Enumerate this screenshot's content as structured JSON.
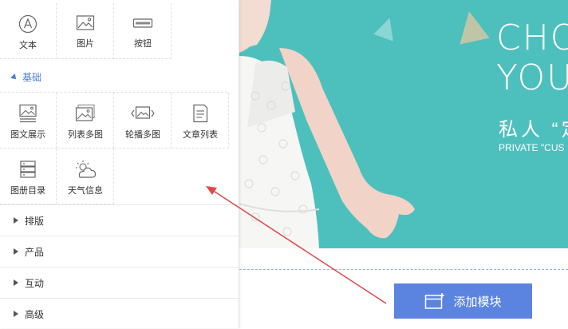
{
  "panel": {
    "top_items": [
      {
        "label": "文本",
        "icon": "text-icon"
      },
      {
        "label": "图片",
        "icon": "image-icon"
      },
      {
        "label": "按钮",
        "icon": "button-icon"
      }
    ],
    "basic_section": {
      "label": "基础",
      "items": [
        {
          "label": "图文展示",
          "icon": "image-text-icon"
        },
        {
          "label": "列表多图",
          "icon": "list-images-icon"
        },
        {
          "label": "轮播多图",
          "icon": "carousel-icon"
        },
        {
          "label": "文章列表",
          "icon": "article-list-icon"
        },
        {
          "label": "图册目录",
          "icon": "album-catalog-icon"
        },
        {
          "label": "天气信息",
          "icon": "weather-icon"
        }
      ]
    },
    "categories": [
      {
        "label": "排版"
      },
      {
        "label": "产品"
      },
      {
        "label": "互动"
      },
      {
        "label": "高级"
      }
    ]
  },
  "banner": {
    "line1": "CHO",
    "line2": "YOU",
    "cn": "私人 “定",
    "en": "PRIVATE \"CUS"
  },
  "add_module": {
    "label": "添加模块"
  },
  "colors": {
    "accent": "#5b84e0",
    "banner_bg": "#4dc0bd",
    "section_blue": "#4a7bd6",
    "arrow": "#e04848"
  }
}
